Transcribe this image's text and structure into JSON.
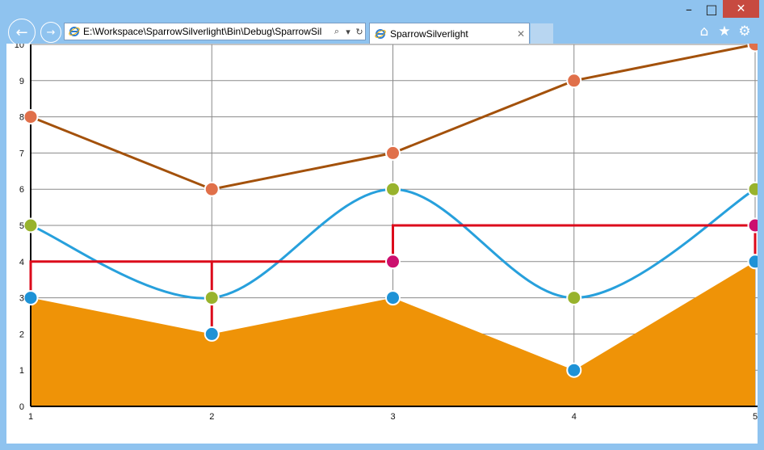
{
  "window": {
    "minimize": "–",
    "maximize": "□",
    "close": "✕"
  },
  "browser": {
    "back_icon": "back-arrow-icon",
    "forward_icon": "forward-arrow-icon",
    "address": "E:\\Workspace\\SparrowSilverlight\\Bin\\Debug\\SparrowSil",
    "search_glyph": "⌕",
    "dropdown_glyph": "▾",
    "refresh_glyph": "↻",
    "tab_title": "SparrowSilverlight",
    "tab_close": "✕",
    "home_glyph": "⌂",
    "favorites_glyph": "★",
    "settings_glyph": "⚙"
  },
  "colors": {
    "area": "#ef9307",
    "spline": "#27a0dc",
    "line": "#a3510b",
    "step": "#dc0a1b",
    "marker_blue": "#1e92d6",
    "marker_olive": "#98b32d",
    "marker_salmon": "#e0704a",
    "marker_magenta": "#cc0f6e"
  },
  "chart_data": {
    "type": "line",
    "x": [
      1,
      2,
      3,
      4,
      5
    ],
    "xlim": [
      1,
      5
    ],
    "ylim": [
      0,
      10
    ],
    "x_ticks": [
      "1",
      "2",
      "3",
      "4",
      "5"
    ],
    "y_ticks": [
      "0",
      "1",
      "2",
      "3",
      "4",
      "5",
      "6",
      "7",
      "8",
      "9",
      "10"
    ],
    "grid": true,
    "legend": "none",
    "series": [
      {
        "kind": "area",
        "values": [
          3,
          2,
          3,
          1,
          4
        ]
      },
      {
        "kind": "spline",
        "values": [
          5,
          3,
          6,
          3,
          6
        ]
      },
      {
        "kind": "line",
        "values": [
          8,
          6,
          7,
          9,
          10
        ]
      },
      {
        "kind": "step",
        "values": [
          4,
          4,
          5,
          5,
          4
        ]
      }
    ]
  }
}
